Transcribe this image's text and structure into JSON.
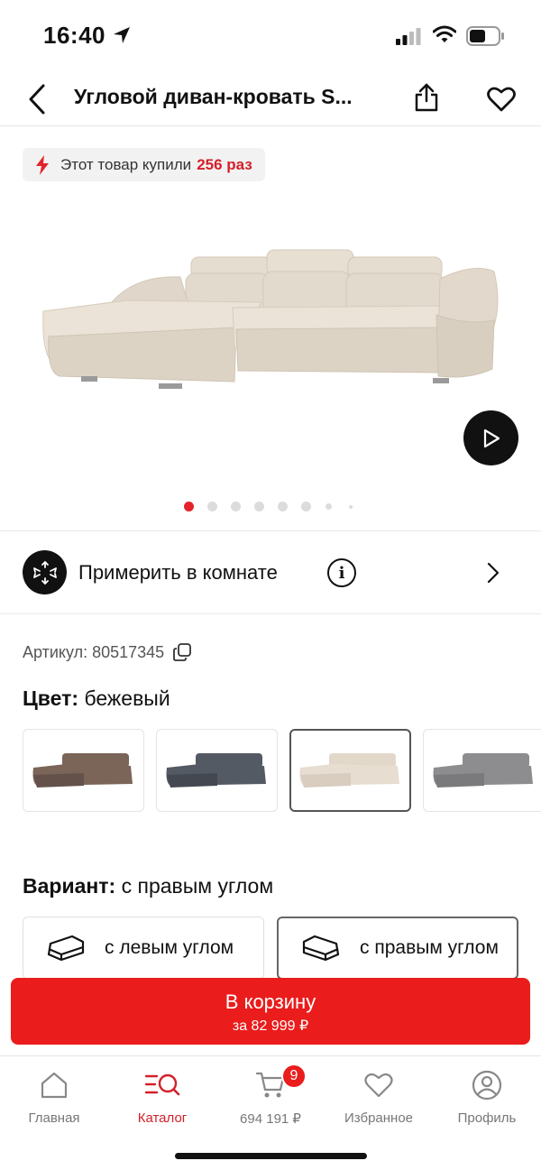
{
  "status": {
    "time": "16:40"
  },
  "header": {
    "title": "Угловой диван-кровать S..."
  },
  "badge": {
    "prefix": "Этот товар купили",
    "count": "256 раз"
  },
  "gallery": {
    "total_dots": 8,
    "active_index": 0
  },
  "ar": {
    "label": "Примерить в комнате",
    "info_glyph": "i"
  },
  "product": {
    "article": "Артикул: 80517345",
    "color_label": "Цвет:",
    "color_value": "бежевый",
    "variant_label": "Вариант:",
    "variant_value": "с правым углом"
  },
  "colors": [
    {
      "name": "brown",
      "hex": "#7a6558"
    },
    {
      "name": "dark-grey",
      "hex": "#545a63"
    },
    {
      "name": "beige",
      "hex": "#e2d8ca",
      "selected": true
    },
    {
      "name": "grey",
      "hex": "#8d8d90"
    }
  ],
  "variants": [
    {
      "label": "с левым углом"
    },
    {
      "label": "с правым углом",
      "selected": true
    }
  ],
  "cart_button": {
    "label": "В корзину",
    "price": "за 82 999 ₽"
  },
  "tabbar": {
    "home": "Главная",
    "catalog": "Каталог",
    "cart": "694 191 ₽",
    "cart_count": "9",
    "favorites": "Избранное",
    "profile": "Профиль"
  },
  "theme": {
    "accent": "#ea1c1c",
    "accent_text": "#d4202a"
  }
}
